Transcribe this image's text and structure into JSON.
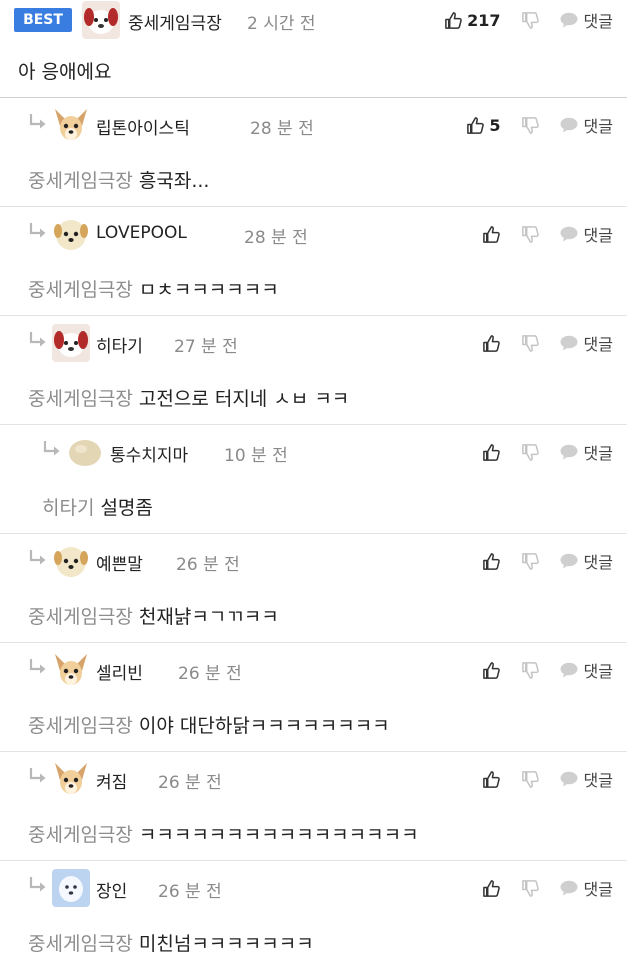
{
  "labels": {
    "best": "BEST",
    "reply": "댓글"
  },
  "best_comment": {
    "author": "중세게임극장",
    "time": "2 시간 전",
    "likes": "217",
    "text": "아 응애에요"
  },
  "replies": [
    {
      "author": "립톤아이스틱",
      "time": "28 분 전",
      "likes": "5",
      "mention": "중세게임극장",
      "text": "흥국좌...",
      "avatar": "chihuahua"
    },
    {
      "author": "LOVEPOOL",
      "time": "28 분 전",
      "likes": "",
      "mention": "중세게임극장",
      "text": "ㅁㅊㅋㅋㅋㅋㅋㅋ",
      "avatar": "dog-round"
    },
    {
      "author": "히타기",
      "time": "27 분 전",
      "likes": "",
      "mention": "중세게임극장",
      "text": "고전으로 터지네 ㅅㅂ ㅋㅋ",
      "avatar": "dog-red"
    },
    {
      "author": "통수치지마",
      "time": "10 분 전",
      "likes": "",
      "mention": "히타기",
      "text": "설명좀",
      "avatar": "blob"
    },
    {
      "author": "예쁜말",
      "time": "26 분 전",
      "likes": "",
      "mention": "중세게임극장",
      "text": "천재냙ㅋㄱㄲㅋㅋ",
      "avatar": "dog-round"
    },
    {
      "author": "셀리빈",
      "time": "26 분 전",
      "likes": "",
      "mention": "중세게임극장",
      "text": "이야 대단하닭ㅋㅋㅋㅋㅋㅋㅋㅋ",
      "avatar": "chihuahua"
    },
    {
      "author": "켜짐",
      "time": "26 분 전",
      "likes": "",
      "mention": "중세게임극장",
      "text": "ㅋㅋㅋㅋㅋㅋㅋㅋㅋㅋㅋㅋㅋㅋㅋㅋ",
      "avatar": "chihuahua"
    },
    {
      "author": "장인",
      "time": "26 분 전",
      "likes": "",
      "mention": "중세게임극장",
      "text": "미친넘ㅋㅋㅋㅋㅋㅋㅋ",
      "avatar": "snow-dog"
    }
  ]
}
